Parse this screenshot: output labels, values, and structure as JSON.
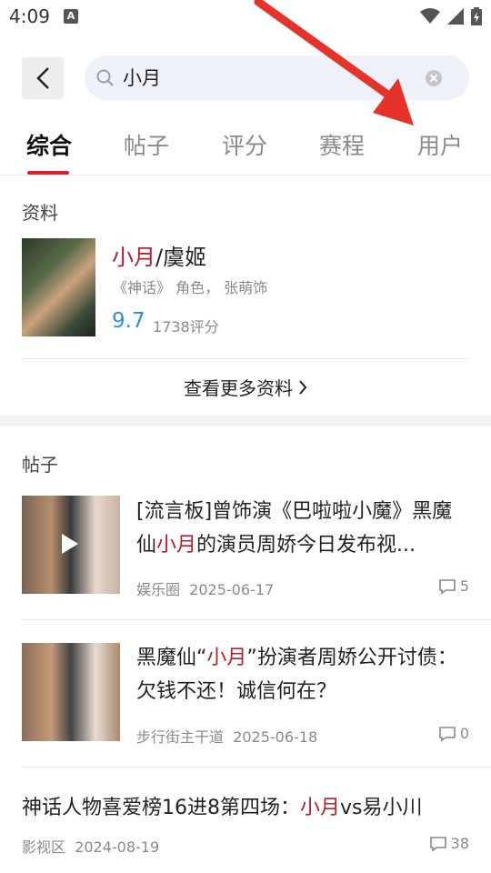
{
  "status": {
    "time": "4:09",
    "notif_badge": "A"
  },
  "search": {
    "query": "小月"
  },
  "tabs": [
    "综合",
    "帖子",
    "评分",
    "赛程",
    "用户"
  ],
  "profile_section": {
    "title": "资料",
    "name_highlight": "小月",
    "name_rest": "/虞姬",
    "desc": "《神话》 角色， 张萌饰",
    "score": "9.7",
    "score_count": "1738评分",
    "more_label": "查看更多资料"
  },
  "posts_section": {
    "title": "帖子",
    "posts": [
      {
        "title_a": "[流言板]曾饰演《巴啦啦小魔》黑魔仙",
        "title_hl": "小月",
        "title_b": "的演员周娇今日发布视...",
        "source": "娱乐圈",
        "date": "2025-06-17",
        "comments": "5"
      },
      {
        "title_a": "黑魔仙“",
        "title_hl": "小月",
        "title_b": "”扮演者周娇公开讨债：欠钱不还！诚信何在？",
        "source": "步行街主干道",
        "date": "2025-06-18",
        "comments": "0"
      },
      {
        "title_a": "神话人物喜爱榜16进8第四场：",
        "title_hl": "小月",
        "title_b": "vs易小川",
        "source": "影视区",
        "date": "2024-08-19",
        "comments": "38"
      }
    ]
  },
  "colors": {
    "accent": "#d7232d",
    "highlight": "#b51f27",
    "score": "#2f8fe6",
    "arrow": "#e5332a"
  }
}
